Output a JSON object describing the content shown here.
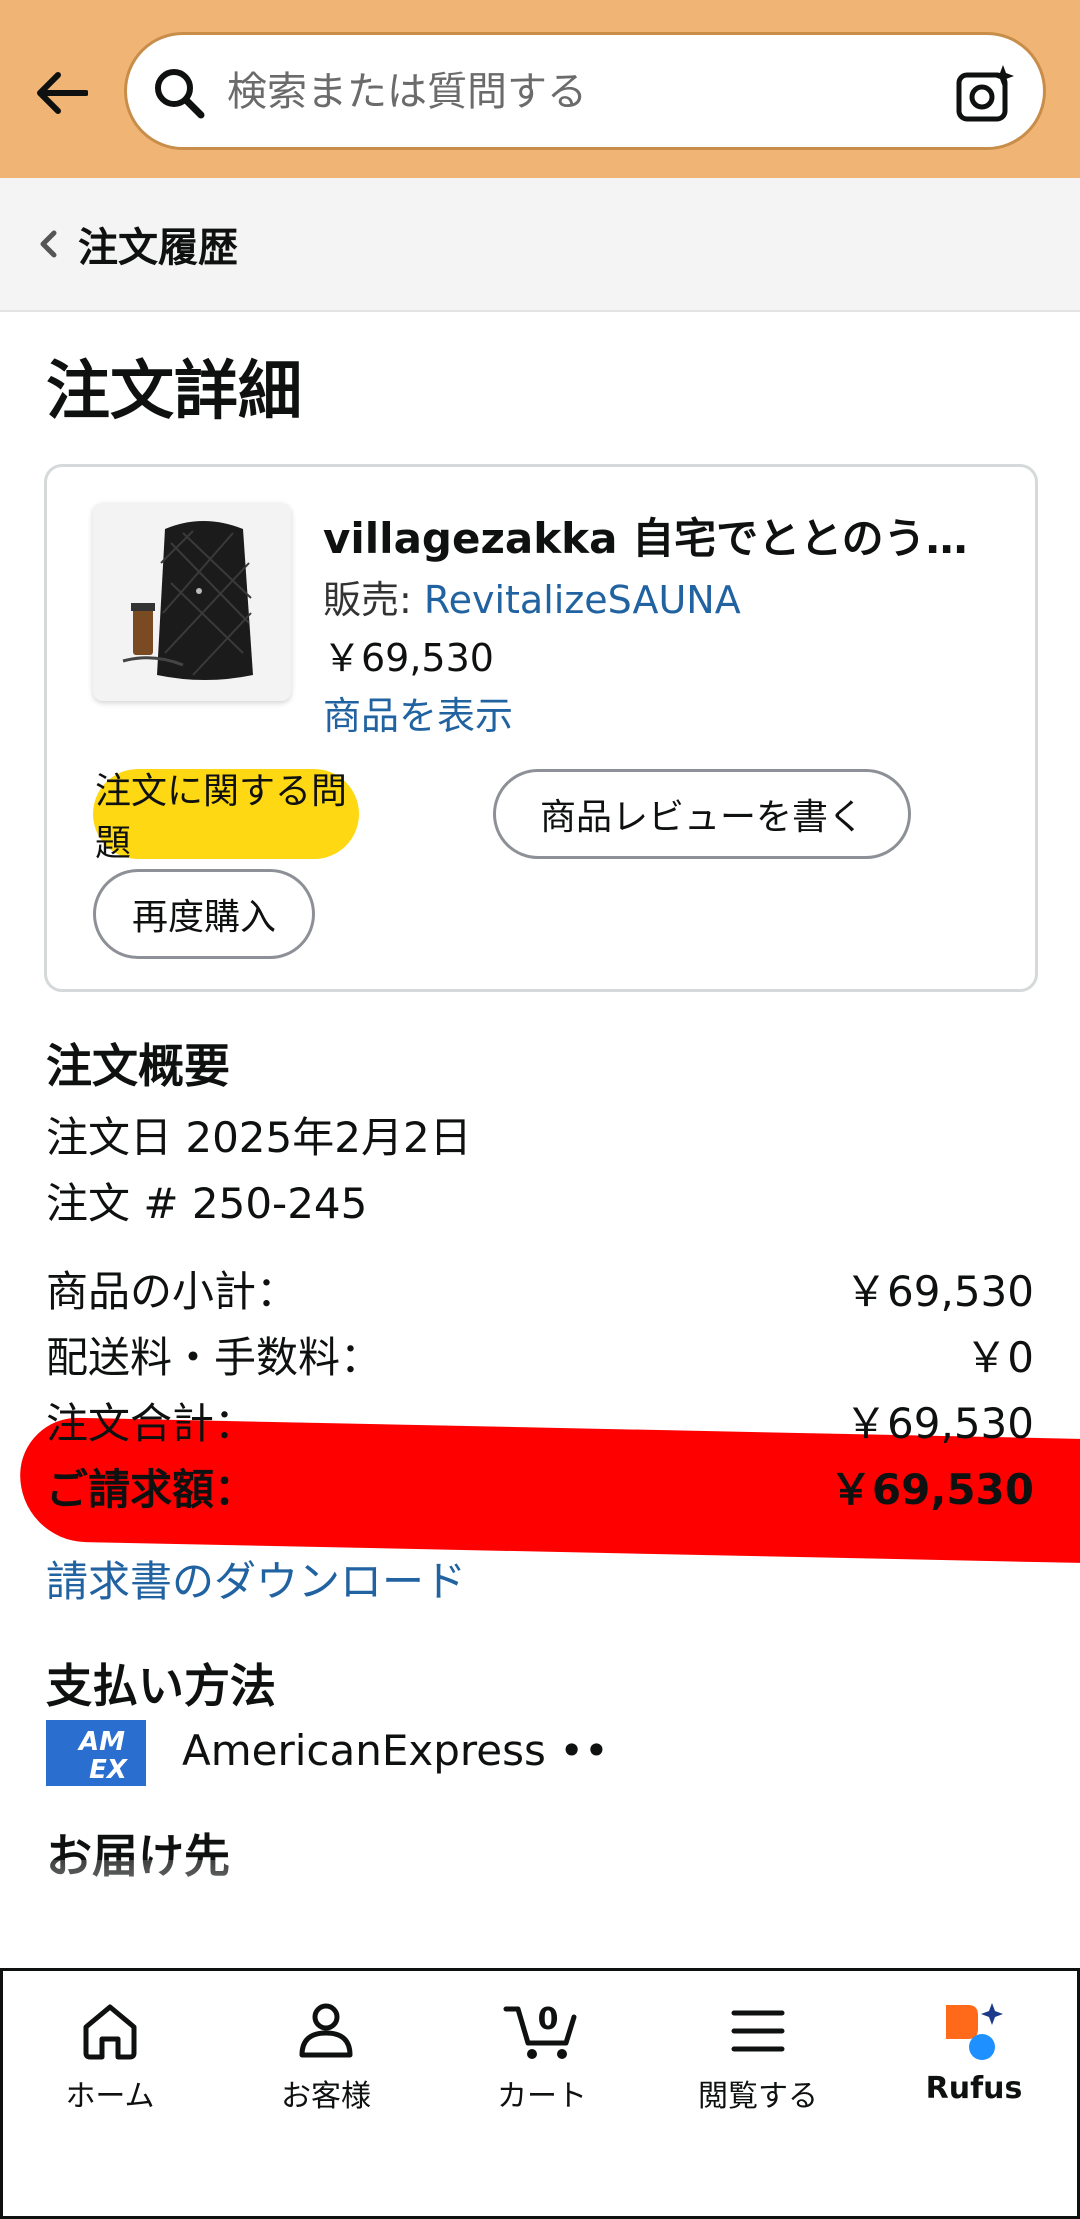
{
  "header": {
    "search_placeholder": "検索または質問する",
    "icons": [
      "back-arrow-icon",
      "search-icon",
      "camera-sparkle-icon"
    ]
  },
  "breadcrumb": {
    "label": "注文履歴"
  },
  "page_title": "注文詳細",
  "product": {
    "title": "villagezakka 自宅でととのう…",
    "seller_prefix": "販売: ",
    "seller_name": "RevitalizeSAUNA",
    "price": "￥69,530",
    "view_link": "商品を表示"
  },
  "actions": {
    "issue_button": "注文に関する問題",
    "review_button": "商品レビューを書く",
    "rebuy_button": "再度購入"
  },
  "summary": {
    "title": "注文概要",
    "order_date": "注文日 2025年2月2日",
    "order_number": "注文 # 250-245",
    "rows": [
      {
        "label": "商品の小計：",
        "value": "￥69,530"
      },
      {
        "label": "配送料・手数料：",
        "value": "￥0"
      },
      {
        "label": "注文合計：",
        "value": "￥69,530"
      },
      {
        "label": "ご請求額：",
        "value": "￥69,530"
      }
    ],
    "invoice_link": "請求書のダウンロード"
  },
  "payment": {
    "title": "支払い方法",
    "card_logo": "AM EX",
    "card_text": "AmericanExpress ••"
  },
  "shipping": {
    "title": "お届け先"
  },
  "bottom_nav": {
    "items": [
      {
        "label": "ホーム",
        "icon": "home-icon"
      },
      {
        "label": "お客様",
        "icon": "account-icon"
      },
      {
        "label": "カート",
        "icon": "cart-icon",
        "count": "0"
      },
      {
        "label": "閲覧する",
        "icon": "menu-icon"
      },
      {
        "label": "Rufus",
        "icon": "rufus-icon"
      }
    ]
  },
  "colors": {
    "header_bg": "#f0b475",
    "link": "#2162a1",
    "primary_button": "#ffd814",
    "highlight_mark": "#ff0000",
    "amex_blue": "#2a6fcf",
    "rufus_orange": "#ff6a1a",
    "rufus_blue": "#1e90ff"
  }
}
